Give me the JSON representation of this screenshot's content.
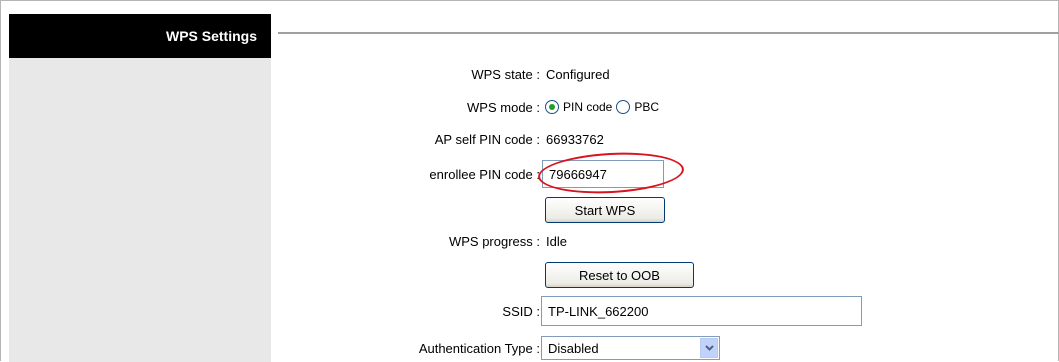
{
  "sidebar": {
    "header": "WPS Settings"
  },
  "form": {
    "wps_state": {
      "label": "WPS state :",
      "value": "Configured"
    },
    "wps_mode": {
      "label": "WPS mode :",
      "options": [
        "PIN code",
        "PBC"
      ],
      "selected": "PIN code"
    },
    "ap_self_pin": {
      "label": "AP self PIN code :",
      "value": "66933762"
    },
    "enrollee_pin": {
      "label": "enrollee PIN code :",
      "value": "79666947"
    },
    "start_wps_button": "Start WPS",
    "wps_progress": {
      "label": "WPS progress :",
      "value": "Idle"
    },
    "reset_button": "Reset to OOB",
    "ssid": {
      "label": "SSID :",
      "value": "TP-LINK_662200"
    },
    "auth_type": {
      "label": "Authentication Type :",
      "value": "Disabled"
    }
  },
  "colors": {
    "header_bg": "#000000",
    "sidebar_bg": "#e8e8e8",
    "annotation": "#d8141e",
    "radio_selected": "#21a121"
  },
  "icons": {
    "select_arrow": "chevron-down-icon"
  }
}
